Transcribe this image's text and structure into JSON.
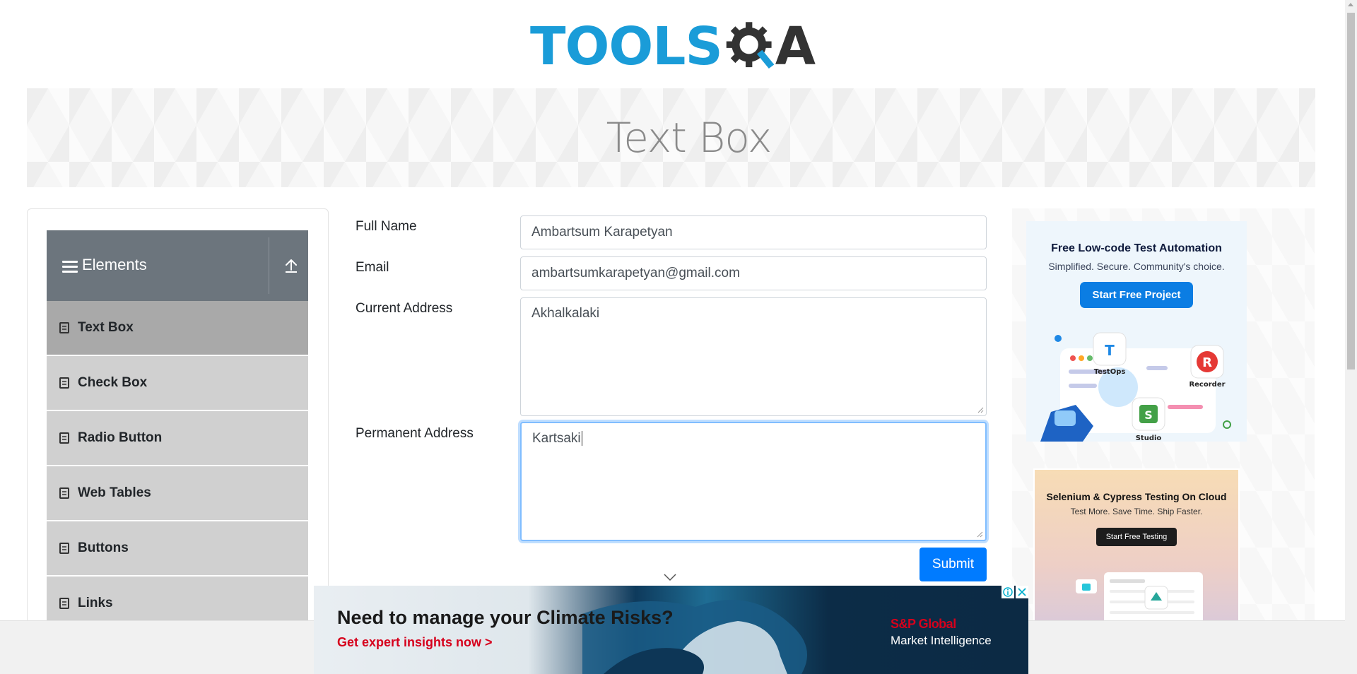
{
  "header": {
    "logo_text_main": "TOOLS",
    "logo_text_end": "A"
  },
  "banner": {
    "title": "Text Box"
  },
  "sidebar": {
    "group_title": "Elements",
    "items": [
      {
        "label": "Text Box",
        "active": true
      },
      {
        "label": "Check Box"
      },
      {
        "label": "Radio Button"
      },
      {
        "label": "Web Tables"
      },
      {
        "label": "Buttons"
      },
      {
        "label": "Links"
      }
    ]
  },
  "form": {
    "full_name_label": "Full Name",
    "full_name_value": "Ambartsum Karapetyan",
    "email_label": "Email",
    "email_value": "ambartsumkarapetyan@gmail.com",
    "current_address_label": "Current Address",
    "current_address_value": "Akhalkalaki",
    "permanent_address_label": "Permanent Address",
    "permanent_address_value": "Kartsaki",
    "submit_label": "Submit"
  },
  "ads": {
    "katalon": {
      "title": "Free Low-code Test Automation",
      "subtitle": "Simplified. Secure. Community's choice.",
      "button": "Start Free Project",
      "labels": [
        "TestOps",
        "Recorder",
        "Studio"
      ]
    },
    "lambdatest": {
      "title": "Selenium & Cypress Testing On Cloud",
      "subtitle": "Test More. Save Time. Ship Faster.",
      "button": "Start Free Testing"
    },
    "bottom": {
      "headline": "Need to manage your Climate Risks?",
      "cta": "Get expert insights now >",
      "brand_line1": "S&P Global",
      "brand_line2": "Market Intelligence"
    }
  },
  "colors": {
    "accent": "#007bff",
    "sidebar_header": "#6c757d",
    "menu_item": "#d0d0d0",
    "menu_item_active": "#a9a9a9",
    "logo_blue": "#1a9cd8"
  }
}
